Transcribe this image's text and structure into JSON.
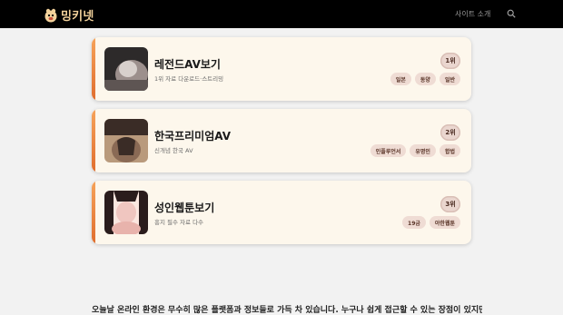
{
  "header": {
    "logo_text": "밍키넷",
    "nav_link": "사이트 소개"
  },
  "cards": [
    {
      "title": "레전드AV보기",
      "desc": "1위 자료 다운로드·스트리밍",
      "rank": "1위",
      "tags": [
        "일본",
        "동양",
        "일반"
      ],
      "thumb_colors": [
        "#2d2a2a",
        "#9c8f8c",
        "#d8d0cc"
      ]
    },
    {
      "title": "한국프리미엄AV",
      "desc": "신개념 한국 AV",
      "rank": "2위",
      "tags": [
        "인플루언서",
        "유명인",
        "합법"
      ],
      "thumb_colors": [
        "#3a2c26",
        "#8a6a55",
        "#b99a7c"
      ]
    },
    {
      "title": "성인웹툰보기",
      "desc": "흥지 필수 자료 다수",
      "rank": "3위",
      "tags": [
        "19금",
        "야한웹툰"
      ],
      "thumb_colors": [
        "#2a1c1c",
        "#f0c6c0",
        "#fbe6df"
      ]
    }
  ],
  "footer": {
    "text": "오늘날 온라인 환경은 무수히 많은 플랫폼과 정보들로 가득 차 있습니다. 누구나 쉽게 접근할 수 있는 장점이 있지만, 동시에"
  },
  "colors": {
    "topbar": "#000000",
    "logo": "#f3d29c",
    "card_bg": "#fdf7ec",
    "accent": "#e06d2d"
  }
}
